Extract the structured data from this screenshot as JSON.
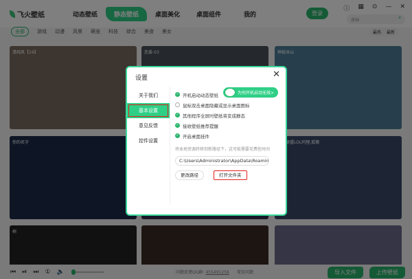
{
  "app": {
    "name": "飞火壁纸"
  },
  "nav": [
    "动态壁纸",
    "静态壁纸",
    "桌面美化",
    "桌面组件",
    "我的"
  ],
  "login": "登录",
  "search": {
    "placeholder": "搜袖"
  },
  "categories": [
    "全部",
    "游戏",
    "动漫",
    "风景",
    "萌宠",
    "科技",
    "综合",
    "美食",
    "美女"
  ],
  "sort": [
    "最热",
    "最新"
  ],
  "cards": [
    {
      "title": "清纯风【19】",
      "color": "#7a6a5e"
    },
    {
      "title": "恋爱-03",
      "color": "#4a5058"
    },
    {
      "title": "神秘冰山",
      "color": "#4f7f99"
    },
    {
      "title": "你的名字",
      "color": "#1c2a4a"
    },
    {
      "title": "",
      "color": "#2a3350"
    },
    {
      "title": "英雄联盟LOL阿狸,孤傲",
      "color": "#3a4a6a"
    },
    {
      "title": "树",
      "color": "#222"
    },
    {
      "title": "",
      "color": "#3a2a22"
    },
    {
      "title": "",
      "color": "#6a6a8a"
    }
  ],
  "modal": {
    "title": "设置",
    "side": [
      "关于我们",
      "基本设置",
      "意见反馈",
      "控件设置"
    ],
    "options": [
      {
        "label": "开机启动动态壁纸",
        "checked": true
      },
      {
        "label": "鼠标双击桌面隐藏或显示桌面图标",
        "checked": false
      },
      {
        "label": "其他程序全屏时壁纸将变成静态",
        "checked": true
      },
      {
        "label": "接收壁纸推荐提醒",
        "checked": true
      },
      {
        "label": "开启桌面挂件",
        "checked": true
      }
    ],
    "tip": "为何开机启动无效>",
    "note": "将本地资源转移到新路径下，这可能需要花费些时间",
    "path": "C:\\Users\\Administrator\\AppData\\Roaming",
    "change_path": "更改路径",
    "open_folder": "打开文件夹"
  },
  "bottom": {
    "qq_label": "问题反馈QQ群:",
    "qq": "455491256",
    "faq": "常见问题",
    "import": "导入文件",
    "upload": "上传壁纸"
  }
}
